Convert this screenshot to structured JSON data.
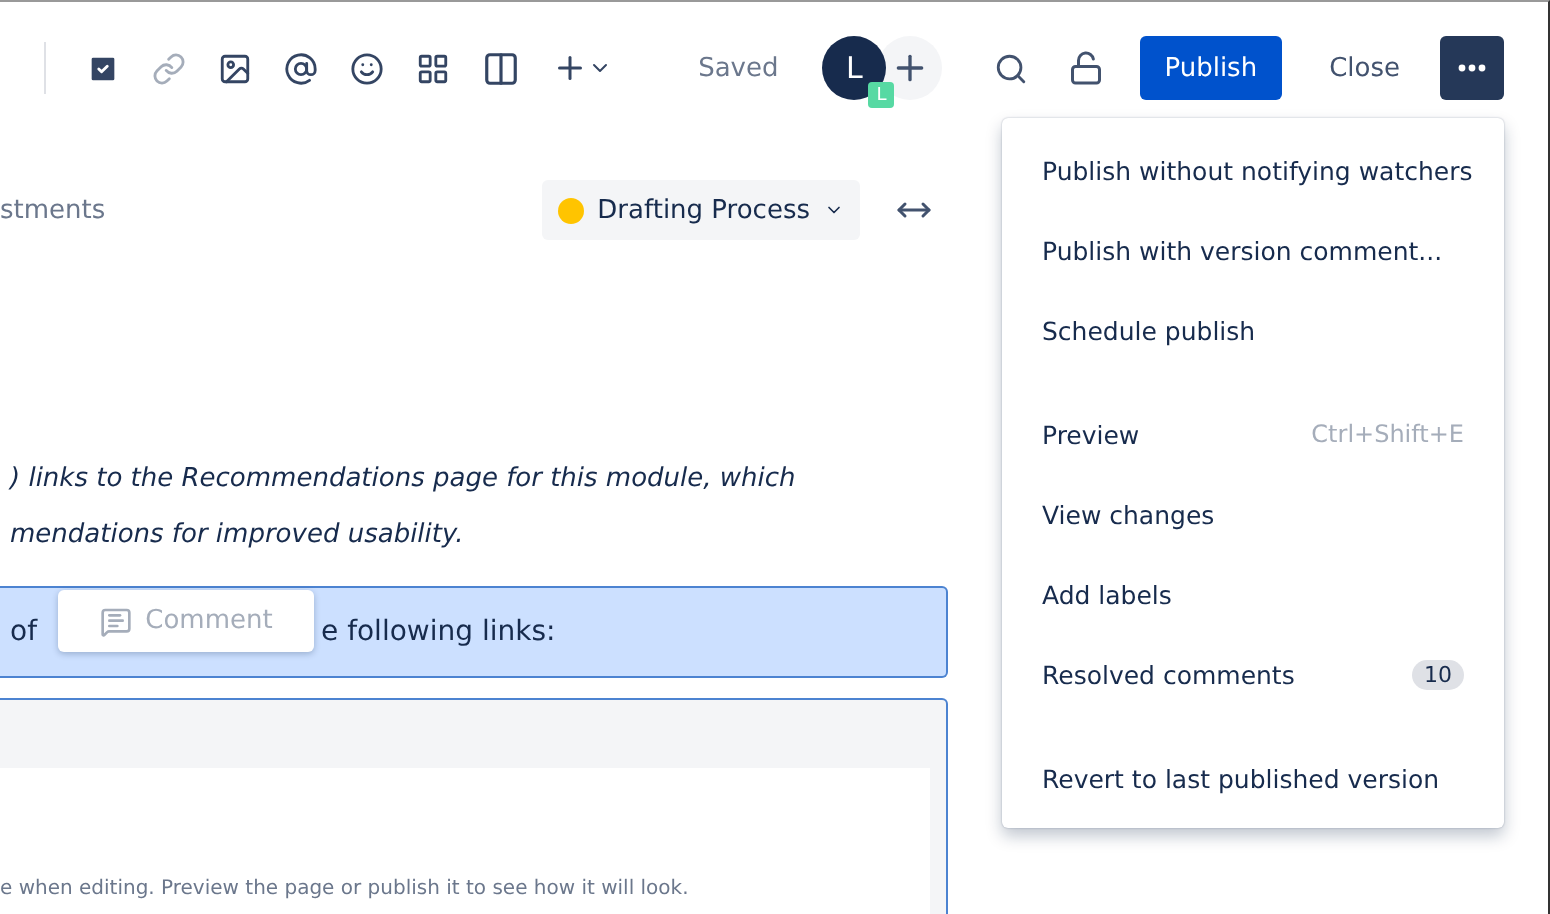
{
  "toolbar": {
    "tools": [
      {
        "kind": "checkbox",
        "disabled": false
      },
      {
        "kind": "link",
        "disabled": true
      },
      {
        "kind": "image",
        "disabled": false
      },
      {
        "kind": "mention",
        "disabled": false
      },
      {
        "kind": "emoji",
        "disabled": false
      },
      {
        "kind": "table",
        "disabled": false
      },
      {
        "kind": "layout",
        "disabled": false
      },
      {
        "kind": "insert",
        "disabled": false
      }
    ],
    "status": "Saved",
    "avatar": {
      "initial": "L",
      "badge": "L"
    },
    "publish": "Publish",
    "close": "Close"
  },
  "breadcrumb": "stments",
  "page_status": {
    "label": "Drafting Process",
    "color": "#ffc400"
  },
  "paragraph": [
    ") links to the Recommendations page for this module, which",
    "mendations for improved usability."
  ],
  "highlight_block": {
    "before": "of",
    "after": "e following links:"
  },
  "comment_popup": "Comment",
  "panel_note": "e when editing. Preview the page or publish it to see how it will look.",
  "menu": {
    "groups": [
      [
        {
          "label": "Publish without notifying watchers"
        },
        {
          "label": "Publish with version comment..."
        },
        {
          "label": "Schedule publish"
        }
      ],
      [
        {
          "label": "Preview",
          "shortcut": "Ctrl+Shift+E"
        },
        {
          "label": "View changes"
        },
        {
          "label": "Add labels"
        },
        {
          "label": "Resolved comments",
          "badge": "10"
        }
      ],
      [
        {
          "label": "Revert to last published version"
        }
      ]
    ]
  }
}
